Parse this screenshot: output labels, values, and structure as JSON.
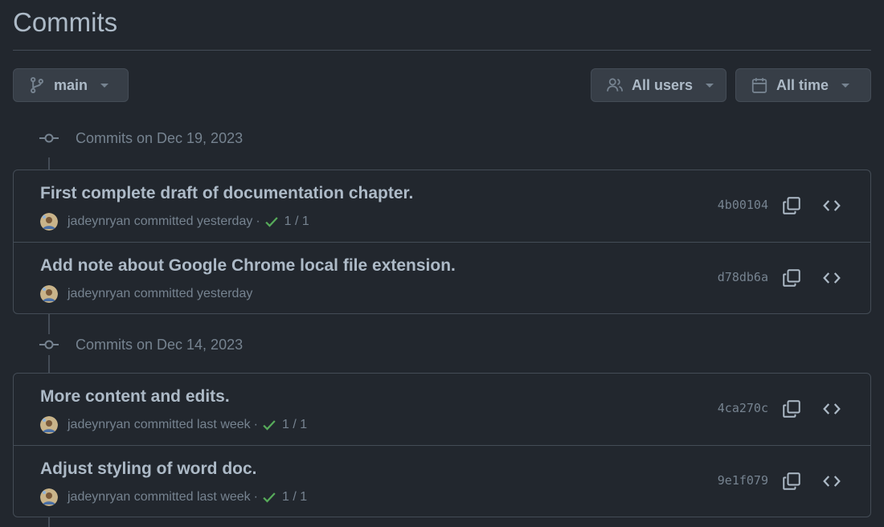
{
  "header": {
    "title": "Commits"
  },
  "toolbar": {
    "branch": {
      "label": "main",
      "icon": "git-branch-icon"
    },
    "users": {
      "label": "All users",
      "icon": "people-icon"
    },
    "time": {
      "label": "All time",
      "icon": "calendar-icon"
    }
  },
  "groups": [
    {
      "heading": "Commits on Dec 19, 2023",
      "commits": [
        {
          "message": "First complete draft of documentation chapter.",
          "author": "jadeynryan",
          "when": "committed yesterday",
          "checks": "1 / 1",
          "sha": "4b00104"
        },
        {
          "message": "Add note about Google Chrome local file extension.",
          "author": "jadeynryan",
          "when": "committed yesterday",
          "checks": "",
          "sha": "d78db6a"
        }
      ]
    },
    {
      "heading": "Commits on Dec 14, 2023",
      "commits": [
        {
          "message": "More content and edits.",
          "author": "jadeynryan",
          "when": "committed last week",
          "checks": "1 / 1",
          "sha": "4ca270c"
        },
        {
          "message": "Adjust styling of word doc.",
          "author": "jadeynryan",
          "when": "committed last week",
          "checks": "1 / 1",
          "sha": "9e1f079"
        }
      ]
    }
  ],
  "colors": {
    "background": "#22272e",
    "border": "#444c56",
    "text": "#adbac7",
    "muted": "#768390",
    "success": "#57ab5a"
  }
}
